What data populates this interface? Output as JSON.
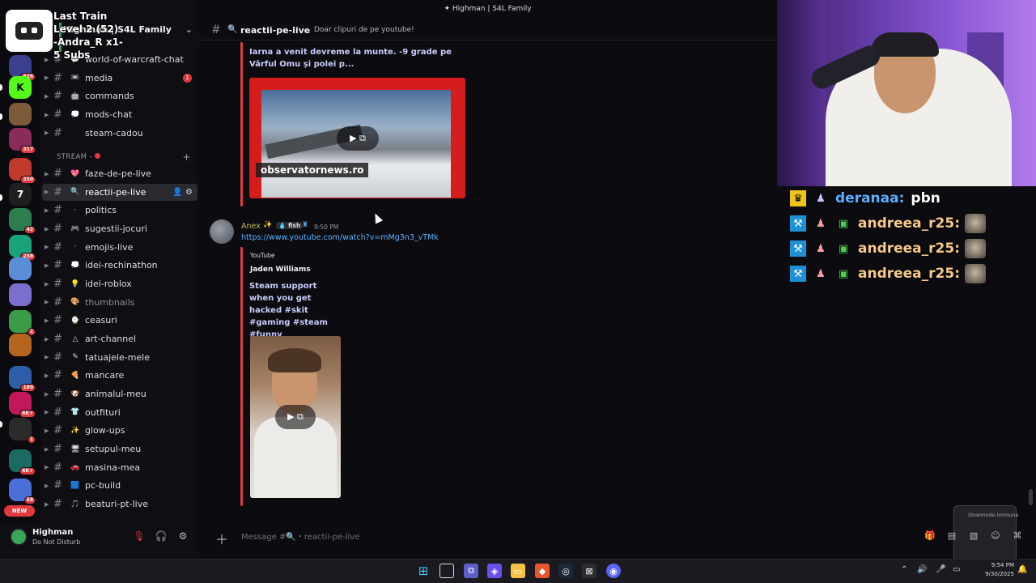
{
  "window": {
    "title": "Highman | S4L Family"
  },
  "overlay": {
    "lines": [
      "Last Train",
      "Level 2 (52)",
      "-Andra_R x1-",
      "5 Subs"
    ]
  },
  "server": {
    "name": "Highman | S4L Family"
  },
  "rail": {
    "badges": [
      "626",
      "317",
      "350",
      "2",
      "42",
      "258",
      "2",
      "2",
      "180",
      "6K+",
      "1",
      "6K+",
      "58"
    ],
    "new_label": "NEW"
  },
  "sidebar": {
    "category_stream": "STREAM -",
    "channels_top": [
      {
        "name": "world-of-warcraft-chat",
        "emoji": "💬"
      },
      {
        "name": "media",
        "emoji": "📼",
        "unread": "1"
      },
      {
        "name": "commands",
        "emoji": "🤖"
      },
      {
        "name": "mods-chat",
        "emoji": "💭"
      },
      {
        "name": "steam-cadou",
        "emoji": ""
      }
    ],
    "channels_stream": [
      {
        "name": "faze-de-pe-live",
        "emoji": "💖"
      },
      {
        "name": "reactii-pe-live",
        "emoji": "🔍",
        "active": true
      },
      {
        "name": "politics",
        "emoji": "·"
      },
      {
        "name": "sugestii-jocuri",
        "emoji": "🎮"
      },
      {
        "name": "emojis-live",
        "emoji": "·"
      },
      {
        "name": "idei-rechinathon",
        "emoji": "💭"
      },
      {
        "name": "idei-roblox",
        "emoji": "💡"
      },
      {
        "name": "thumbnails",
        "emoji": "🎨",
        "muted": true
      },
      {
        "name": "ceasuri",
        "emoji": "⌚"
      },
      {
        "name": "art-channel",
        "emoji": "△"
      },
      {
        "name": "tatuajele-mele",
        "emoji": "✎"
      },
      {
        "name": "mancare",
        "emoji": "🍕"
      },
      {
        "name": "animalul-meu",
        "emoji": "🐶"
      },
      {
        "name": "outfituri",
        "emoji": "👕"
      },
      {
        "name": "glow-ups",
        "emoji": "✨"
      },
      {
        "name": "setupul-meu",
        "emoji": "🖥"
      },
      {
        "name": "masina-mea",
        "emoji": "🚗"
      },
      {
        "name": "pc-build",
        "emoji": "🟦"
      },
      {
        "name": "beaturi-pt-live",
        "emoji": "🎵"
      }
    ]
  },
  "user": {
    "name": "Highman",
    "status": "Do Not Disturb"
  },
  "channel": {
    "name": "reactii-pe-live",
    "topic": "Doar clipuri de pe youtube!"
  },
  "messages": {
    "embed1": {
      "title": "Iarna a venit devreme la munte. -9 grade pe Vârful Omu și polei p...",
      "caption": "observatornews.ro"
    },
    "msg2": {
      "author": "Anex",
      "tag": "fish",
      "time": "9:50 PM",
      "link": "https://www.youtube.com/watch?v=mMg3n3_vTMk",
      "embed": {
        "provider": "YouTube",
        "author": "Jaden Williams",
        "title": "Steam support when you get hacked #skit #gaming #steam #funny"
      }
    }
  },
  "composer": {
    "placeholder": "Message #🔍・reactii-pe-live"
  },
  "stream_chat": [
    {
      "name": "deranaa",
      "message": "pbn",
      "color": "#5ab0ff"
    },
    {
      "name": "andreea_r25",
      "message": "",
      "color": "#f5c98a"
    },
    {
      "name": "andreea_r25",
      "message": "",
      "color": "#f5c98a"
    },
    {
      "name": "andreea_r25",
      "message": "",
      "color": "#f5c98a"
    }
  ],
  "slowmode": {
    "label": "Slowmode Immune"
  },
  "taskbar": {
    "time": "9:54 PM",
    "date": "9/30/2025"
  },
  "colors": {
    "accent": "#5865f2",
    "red": "#e0393e",
    "link": "#5ab0ff"
  }
}
